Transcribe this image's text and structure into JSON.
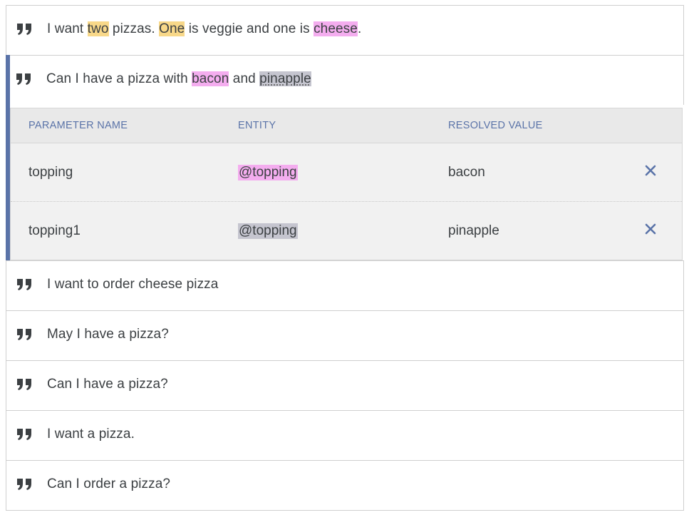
{
  "training_phrases": [
    {
      "segments": [
        {
          "text": "I want ",
          "hl": ""
        },
        {
          "text": "two",
          "hl": "yellow"
        },
        {
          "text": " pizzas. ",
          "hl": ""
        },
        {
          "text": "One",
          "hl": "yellow"
        },
        {
          "text": " is veggie and one is ",
          "hl": ""
        },
        {
          "text": "cheese",
          "hl": "pink"
        },
        {
          "text": ".",
          "hl": ""
        }
      ]
    },
    {
      "segments": [
        {
          "text": "Can I have a pizza with ",
          "hl": ""
        },
        {
          "text": "bacon",
          "hl": "pink"
        },
        {
          "text": " and ",
          "hl": ""
        },
        {
          "text": "pinapple",
          "hl": "gray"
        }
      ],
      "expanded": true
    },
    {
      "text": "I want to order cheese pizza"
    },
    {
      "text": "May I have a pizza?"
    },
    {
      "text": "Can I have a pizza?"
    },
    {
      "text": "I want a pizza."
    },
    {
      "text": "Can I order a pizza?"
    }
  ],
  "parameter_table": {
    "headers": {
      "name": "PARAMETER NAME",
      "entity": "ENTITY",
      "value": "RESOLVED VALUE"
    },
    "rows": [
      {
        "name": "topping",
        "entity": "@topping",
        "entity_hl": "pink",
        "value": "bacon"
      },
      {
        "name": "topping1",
        "entity": "@topping",
        "entity_hl": "gray",
        "value": "pinapple"
      }
    ]
  },
  "colors": {
    "accent": "#5a73a8",
    "highlight_yellow": "#f8d889",
    "highlight_pink": "#f4adef",
    "highlight_gray": "#c5c5cf"
  },
  "icons": {
    "phrase": "quote-icon",
    "delete": "close-icon"
  }
}
